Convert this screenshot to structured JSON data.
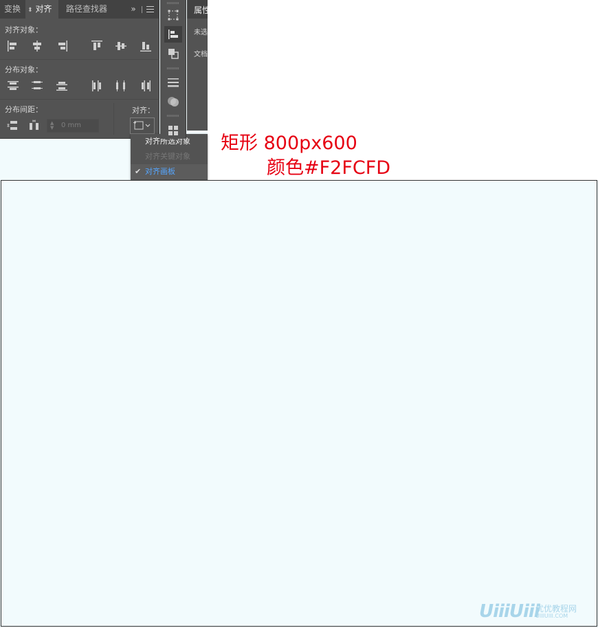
{
  "panel": {
    "tabs": [
      {
        "label": "变换",
        "active": false
      },
      {
        "label": "对齐",
        "active": true
      },
      {
        "label": "路径查找器",
        "active": false
      }
    ],
    "more_glyph": "»",
    "align_objects_label": "对齐对象：",
    "distribute_objects_label": "分布对象：",
    "distribute_spacing_label": "分布间距：",
    "align_to_label": "对齐：",
    "spacing_value": "0 mm"
  },
  "align_to_menu": {
    "items": [
      {
        "label": "对齐所选对象",
        "state": "normal"
      },
      {
        "label": "对齐关键对象",
        "state": "disabled"
      },
      {
        "label": "对齐画板",
        "state": "checked"
      }
    ],
    "check_glyph": "✔"
  },
  "properties_panel": {
    "title": "属性",
    "line1": "未选",
    "line2": "文档"
  },
  "annotation": {
    "line1": "矩形 800px600",
    "line2": "颜色#F2FCFD"
  },
  "watermark": {
    "logo": "UiiiUiii",
    "name": "优优教程网",
    "url": "UIIIUIII.COM"
  },
  "colors": {
    "artboard_fill": "#F2FCFD",
    "annotation": "#e60012",
    "menu_checked": "#55a6ff"
  }
}
